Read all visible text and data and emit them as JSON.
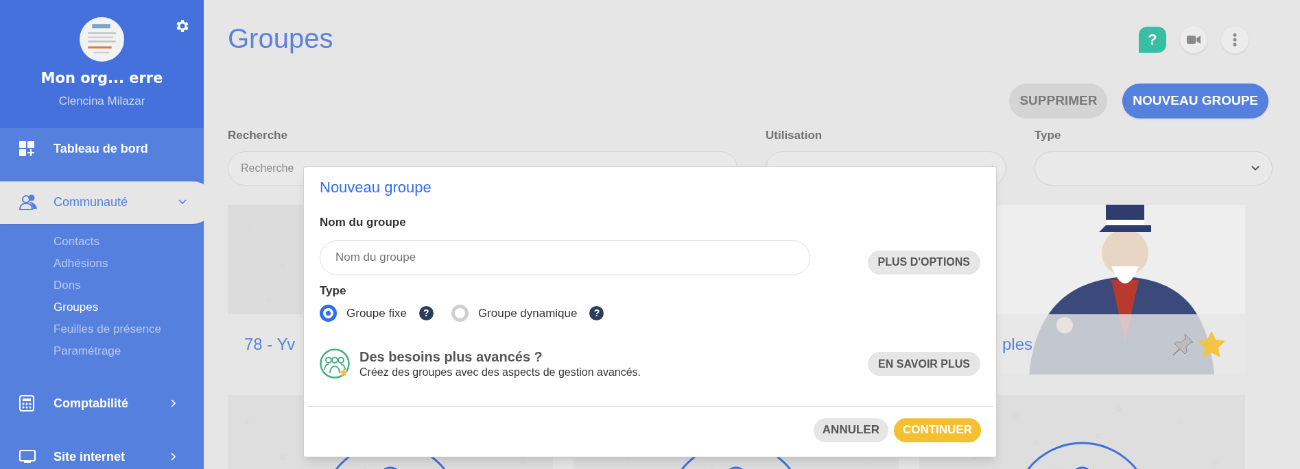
{
  "sidebar": {
    "org_name": "Mon org... erre",
    "user_name": "Clencina Milazar",
    "menu": [
      {
        "label": "Tableau de bord",
        "selected": false
      },
      {
        "label": "Communauté",
        "selected": true,
        "expanded": true,
        "children": [
          {
            "label": "Contacts",
            "selected": false
          },
          {
            "label": "Adhésions",
            "selected": false
          },
          {
            "label": "Dons",
            "selected": false
          },
          {
            "label": "Groupes",
            "selected": true
          },
          {
            "label": "Feuilles de présence",
            "selected": false
          },
          {
            "label": "Paramétrage",
            "selected": false
          }
        ]
      },
      {
        "label": "Comptabilité",
        "selected": false,
        "expanded": false
      },
      {
        "label": "Site internet",
        "selected": false,
        "expanded": false
      }
    ]
  },
  "page": {
    "title": "Groupes",
    "help": "?",
    "actions": [
      {
        "label": "SUPPRIMER",
        "kind": "secondary"
      },
      {
        "label": "NOUVEAU GROUPE",
        "kind": "primary"
      }
    ],
    "filters": [
      {
        "label": "Recherche",
        "kind": "text",
        "placeholder": "Recherche"
      },
      {
        "label": "Utilisation",
        "kind": "select"
      },
      {
        "label": "Type",
        "kind": "select"
      }
    ],
    "cards": [
      {
        "kind": "pattern",
        "title": "78 - Yv"
      },
      {
        "kind": "hidden"
      },
      {
        "kind": "picture",
        "title": "ples",
        "pinned": false,
        "starred": true
      },
      {
        "kind": "circle"
      },
      {
        "kind": "circle"
      },
      {
        "kind": "circle"
      }
    ]
  },
  "dialog": {
    "title": "Nouveau groupe",
    "name_label": "Nom du groupe",
    "name_placeholder": "Nom du groupe",
    "options_button": "PLUS D'OPTIONS",
    "type_label": "Type",
    "type_options": [
      {
        "label": "Groupe fixe",
        "selected": true,
        "help": "?"
      },
      {
        "label": "Groupe dynamique",
        "selected": false,
        "help": "?"
      }
    ],
    "advanced": {
      "title": "Des besoins plus avancés ?",
      "text": "Créez des groupes avec des aspects de gestion avancés.",
      "button": "EN SAVOIR PLUS"
    },
    "buttons": [
      {
        "label": "ANNULER",
        "kind": "cancel"
      },
      {
        "label": "CONTINUER",
        "kind": "confirm"
      }
    ]
  }
}
